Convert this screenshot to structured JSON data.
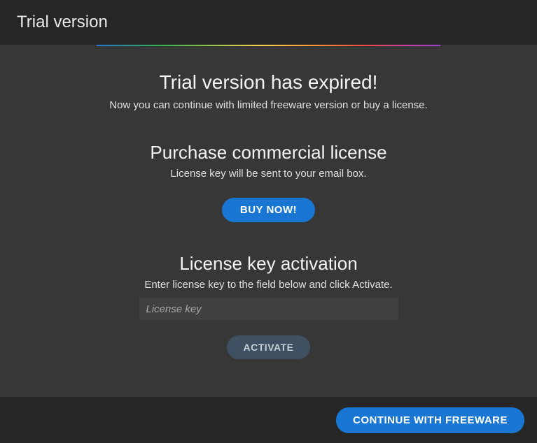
{
  "titlebar": {
    "title": "Trial version"
  },
  "expired": {
    "heading": "Trial version has expired!",
    "subtext": "Now you can continue with limited freeware version or buy a license."
  },
  "purchase": {
    "heading": "Purchase commercial license",
    "subtext": "License key will be sent to your email box.",
    "button_label": "BUY NOW!"
  },
  "activation": {
    "heading": "License key activation",
    "subtext": "Enter license key to the field below and click Activate.",
    "input_placeholder": "License key",
    "input_value": "",
    "button_label": "ACTIVATE"
  },
  "footer": {
    "continue_label": "CONTINUE WITH FREEWARE"
  }
}
